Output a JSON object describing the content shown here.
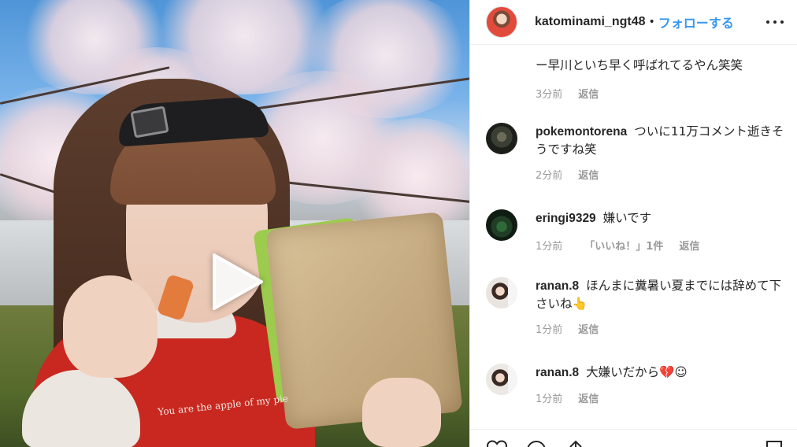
{
  "header": {
    "username": "katominami_ngt48",
    "separator": "•",
    "follow_label": "フォローする"
  },
  "media": {
    "shirt_text": "You are the apple of my pie"
  },
  "comments": [
    {
      "user": "",
      "text": "ー早川といち早く呼ばれてるやん笑笑",
      "time": "3分前",
      "likes": "",
      "reply": "返信"
    },
    {
      "user": "pokemontorena",
      "text": "ついに11万コメント逝きそうですね笑",
      "time": "2分前",
      "likes": "",
      "reply": "返信"
    },
    {
      "user": "eringi9329",
      "text": "嫌いです",
      "time": "1分前",
      "likes": "「いいね！」1件",
      "reply": "返信"
    },
    {
      "user": "ranan.8",
      "text": "ほんまに糞暑い夏までには辞めて下さいね👆",
      "time": "1分前",
      "likes": "",
      "reply": "返信"
    },
    {
      "user": "ranan.8",
      "text": "大嫌いだから💔☺",
      "time": "1分前",
      "likes": "",
      "reply": "返信"
    }
  ],
  "icons": {
    "like": "heart-icon",
    "comment": "comment-icon",
    "share": "share-icon",
    "save": "bookmark-icon",
    "more": "more-icon",
    "play": "play-icon"
  },
  "colors": {
    "accent": "#3897f0",
    "text": "#262626",
    "muted": "#999999",
    "divider": "#efefef"
  }
}
